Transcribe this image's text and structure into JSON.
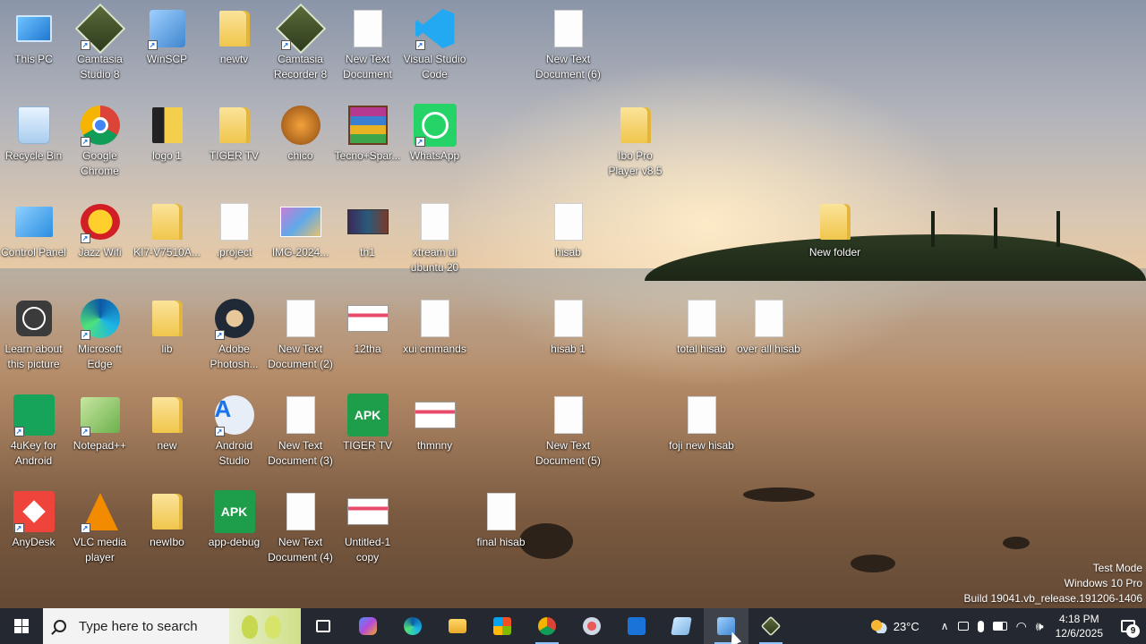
{
  "desktop": {
    "icons": [
      {
        "label": "This PC",
        "icon": "this-pc-icon"
      },
      {
        "label": "Camtasia Studio 8",
        "icon": "camtasia-icon"
      },
      {
        "label": "WinSCP",
        "icon": "winscp-icon"
      },
      {
        "label": "newtv",
        "icon": "folder-icon"
      },
      {
        "label": "Camtasia Recorder 8",
        "icon": "camtasia-recorder-icon"
      },
      {
        "label": "New Text Document",
        "icon": "text-document-icon"
      },
      {
        "label": "Visual Studio Code",
        "icon": "vscode-icon"
      },
      {
        "label": "New Text Document (6)",
        "icon": "text-document-icon"
      },
      {
        "label": "Recycle Bin",
        "icon": "recycle-bin-icon"
      },
      {
        "label": "Google Chrome",
        "icon": "chrome-icon"
      },
      {
        "label": "logo 1",
        "icon": "folder-icon"
      },
      {
        "label": "TIGER TV",
        "icon": "folder-icon"
      },
      {
        "label": "chico",
        "icon": "tiger-image-icon"
      },
      {
        "label": "Tecno+Spar...",
        "icon": "winrar-icon"
      },
      {
        "label": "WhatsApp",
        "icon": "whatsapp-icon"
      },
      {
        "label": "Ibo Pro Player v8.5",
        "icon": "folder-icon"
      },
      {
        "label": "Control Panel",
        "icon": "control-panel-icon"
      },
      {
        "label": "Jazz Wifi",
        "icon": "jazz-icon"
      },
      {
        "label": "KI7-V7510A...",
        "icon": "folder-icon"
      },
      {
        "label": ".project",
        "icon": "file-icon"
      },
      {
        "label": "IMG-2024...",
        "icon": "image-icon"
      },
      {
        "label": "th1",
        "icon": "image-icon"
      },
      {
        "label": "xtream ui ubuntu 20",
        "icon": "text-document-icon"
      },
      {
        "label": "hisab",
        "icon": "text-document-icon"
      },
      {
        "label": "New folder",
        "icon": "folder-icon"
      },
      {
        "label": "Learn about this picture",
        "icon": "learn-picture-icon"
      },
      {
        "label": "Microsoft Edge",
        "icon": "edge-icon"
      },
      {
        "label": "lib",
        "icon": "folder-icon"
      },
      {
        "label": "Adobe Photosh...",
        "icon": "photoshop-icon"
      },
      {
        "label": "New Text Document (2)",
        "icon": "text-document-icon"
      },
      {
        "label": "12tha",
        "icon": "image-icon"
      },
      {
        "label": "xui cmmands",
        "icon": "text-document-icon"
      },
      {
        "label": "hisab 1",
        "icon": "text-document-icon"
      },
      {
        "label": "total hisab",
        "icon": "text-document-icon"
      },
      {
        "label": "over all hisab",
        "icon": "text-document-icon"
      },
      {
        "label": "4uKey for Android",
        "icon": "4ukey-icon"
      },
      {
        "label": "Notepad++",
        "icon": "notepad-plus-icon"
      },
      {
        "label": "new",
        "icon": "folder-icon"
      },
      {
        "label": "Android Studio",
        "icon": "android-studio-icon"
      },
      {
        "label": "New Text Document (3)",
        "icon": "text-document-icon"
      },
      {
        "label": "TIGER TV",
        "icon": "apk-icon"
      },
      {
        "label": "thmnny",
        "icon": "image-icon"
      },
      {
        "label": "New Text Document (5)",
        "icon": "text-document-icon"
      },
      {
        "label": "foji new hisab",
        "icon": "text-document-icon"
      },
      {
        "label": "AnyDesk",
        "icon": "anydesk-icon"
      },
      {
        "label": "VLC media player",
        "icon": "vlc-icon"
      },
      {
        "label": "newIbo",
        "icon": "folder-icon"
      },
      {
        "label": "app-debug",
        "icon": "apk-icon"
      },
      {
        "label": "New Text Document (4)",
        "icon": "text-document-icon"
      },
      {
        "label": "Untitled-1 copy",
        "icon": "image-icon"
      },
      {
        "label": "final hisab",
        "icon": "text-document-icon"
      }
    ]
  },
  "watermark": {
    "line1": "Test Mode",
    "line2": "Windows 10 Pro",
    "line3": "Build 19041.vb_release.191206-1406"
  },
  "taskbar": {
    "search_placeholder": "Type here to search",
    "apps": [
      "task-view-icon",
      "copilot-icon",
      "edge-icon",
      "file-explorer-icon",
      "microsoft-store-icon",
      "chrome-icon",
      "snipping-tool-icon",
      "outlook-icon",
      "notepad-icon",
      "winscp-icon",
      "camtasia-recorder-icon"
    ],
    "active_app": "winscp-icon",
    "weather_temp": "23°C",
    "time": "4:18 PM",
    "date": "12/6/2025",
    "notification_count": "9"
  },
  "colors": {
    "taskbar": "#202630",
    "accent": "#8fc3ff"
  }
}
